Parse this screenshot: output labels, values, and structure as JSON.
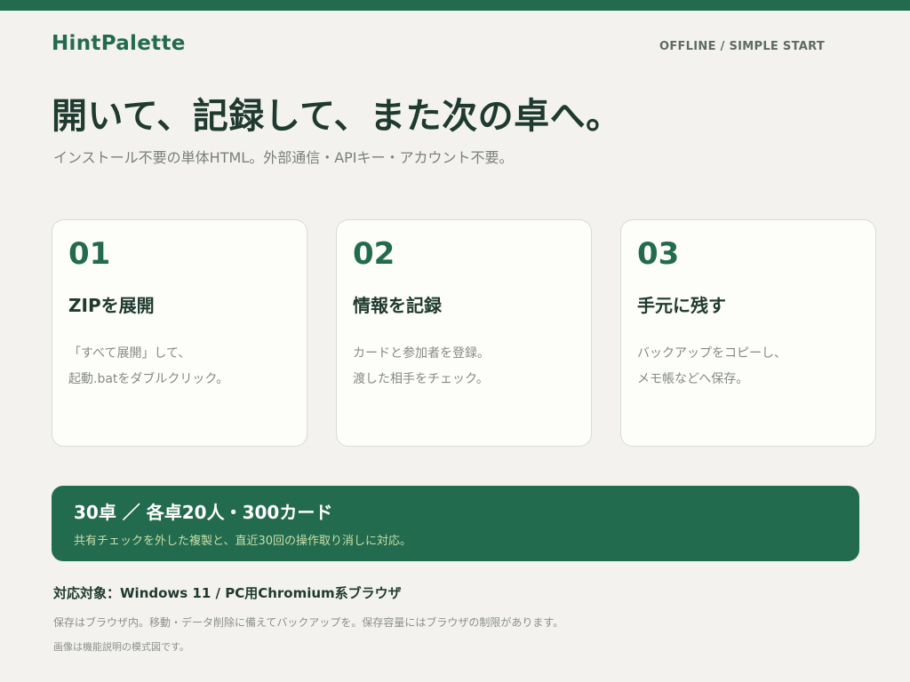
{
  "brand": "HintPalette",
  "tagline": "OFFLINE / SIMPLE START",
  "headline": "開いて、記録して、また次の卓へ。",
  "subline": "インストール不要の単体HTML。外部通信・APIキー・アカウント不要。",
  "cards": [
    {
      "num": "01",
      "title": "ZIPを展開",
      "lines": [
        "「すべて展開」して、",
        "起動.batをダブルクリック。"
      ]
    },
    {
      "num": "02",
      "title": "情報を記録",
      "lines": [
        "カードと参加者を登録。",
        "渡した相手をチェック。"
      ]
    },
    {
      "num": "03",
      "title": "手元に残す",
      "lines": [
        "バックアップをコピーし、",
        "メモ帳などへ保存。"
      ]
    }
  ],
  "banner": {
    "title": "30卓 ／ 各卓20人・300カード",
    "sub": "共有チェックを外した複製と、直近30回の操作取り消しに対応。"
  },
  "support": "対応対象：Windows 11 / PC用Chromium系ブラウザ",
  "note1": "保存はブラウザ内。移動・データ削除に備えてバックアップを。保存容量にはブラウザの制限があります。",
  "note2": "画像は機能説明の模式図です。",
  "colors": {
    "accent": "#236b4f",
    "background": "#f3f2ee",
    "card": "#fdfdf9",
    "banner_sub": "#c9dfa8"
  }
}
